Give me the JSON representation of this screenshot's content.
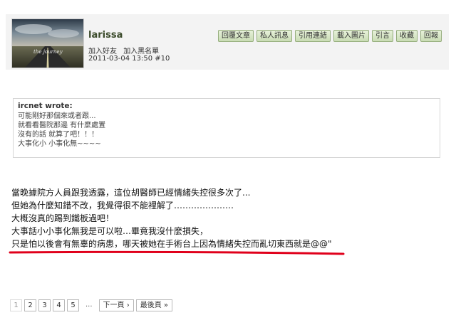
{
  "post": {
    "username": "larissa",
    "avatar_caption": "the journey",
    "user_links": [
      "加入好友",
      "加入黑名單"
    ],
    "meta": "2011-03-04 13:50  #10",
    "actions": [
      "回覆文章",
      "私人訊息",
      "引用連結",
      "載入圖片",
      "引言",
      "收藏",
      "回報"
    ]
  },
  "quote": {
    "header": "ircnet wrote:",
    "lines": [
      "可能剛好那個來或者跟...",
      "就看看醫院那邊 有什麼處置",
      "沒有的話 就算了吧！！！",
      "大事化小 小事化無~~~~"
    ]
  },
  "body_lines": [
    "當晚據院方人員跟我透露，這位胡醫師已經情緒失控很多次了...",
    "但她為什麼知錯不改，我覺得很不能裡解了…………………",
    "大概沒真的踢到鐵板過吧！",
    "大事話小小事化無我是可以啦…畢竟我沒什麼損失，",
    "只是怕以後會有無辜的病患，哪天被她在手術台上因為情緒失控而亂切東西就是@@\""
  ],
  "pagination": {
    "pages": [
      "1",
      "2",
      "3",
      "4",
      "5"
    ],
    "ellipsis": "...",
    "next": "下一頁 ›",
    "last": "最後頁 »"
  },
  "colors": {
    "header_bg": "#f3f3f3",
    "button_bg": "#d9e8c7",
    "username": "#3a4a2a",
    "underline": "#e0001b"
  }
}
